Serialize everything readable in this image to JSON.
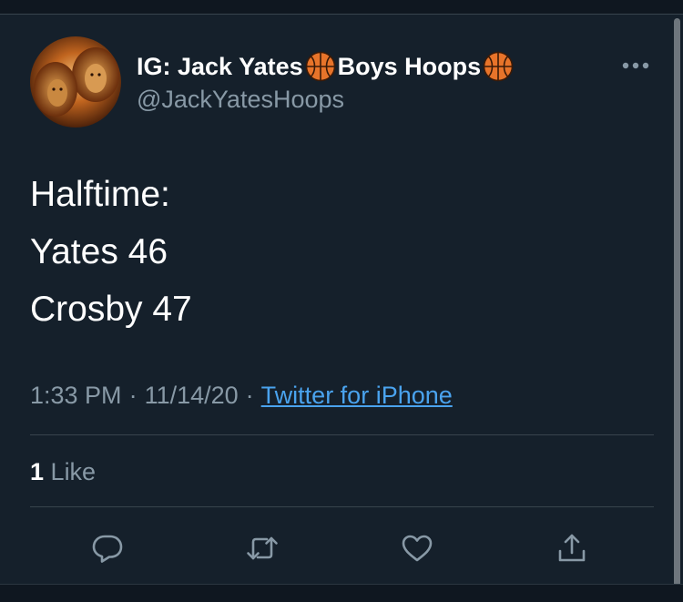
{
  "profile": {
    "display_name_parts": [
      "IG: Jack Yates",
      "Boys Hoops"
    ],
    "handle": "@JackYatesHoops",
    "avatar_icon": "lions-avatar"
  },
  "tweet": {
    "lines": [
      "Halftime:",
      "Yates 46",
      "Crosby 47"
    ],
    "time": "1:33 PM",
    "date": "11/14/20",
    "separator": "·",
    "source": "Twitter for iPhone"
  },
  "engagement": {
    "likes_count": "1",
    "likes_label": "Like"
  },
  "actions": [
    "reply-icon",
    "retweet-icon",
    "like-icon",
    "share-icon"
  ],
  "colors": {
    "background": "#15202b",
    "text": "#ffffff",
    "secondary": "#8899a6",
    "link": "#4aa3ee",
    "divider": "#38444d",
    "basketball": "#e8742a"
  }
}
